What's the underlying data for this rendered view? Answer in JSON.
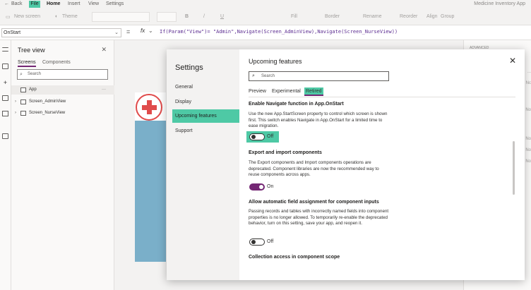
{
  "menubar": {
    "back": "Back",
    "file": "File",
    "home": "Home",
    "insert": "Insert",
    "view": "View",
    "settings": "Settings",
    "app_title": "Medicine Inventory App"
  },
  "toolbar": {
    "new_screen": "New screen",
    "theme": "Theme",
    "font_bold": "B",
    "font_italic": "/",
    "font_underline": "U",
    "fill": "Fill",
    "border": "Border",
    "rename": "Rename",
    "reorder": "Reorder",
    "align": "Align",
    "group": "Group"
  },
  "formula_bar": {
    "property": "OnStart",
    "equals": "=",
    "fx": "fx",
    "formula": "If(Param(\"View\")= \"Admin\",Navigate(Screen_AdminView),Navigate(Screen_NurseView))"
  },
  "tree_view": {
    "title": "Tree view",
    "tabs": [
      "Screens",
      "Components"
    ],
    "search_placeholder": "Search",
    "nodes": [
      {
        "label": "App",
        "more": "···"
      },
      {
        "label": "Screen_AdminView"
      },
      {
        "label": "Screen_NurseView"
      }
    ]
  },
  "right_panel": {
    "label": "ADVANCED",
    "values": [
      "...",
      "Nc",
      "No",
      "No",
      "No",
      "No"
    ]
  },
  "settings_dialog": {
    "title": "Settings",
    "nav": [
      "General",
      "Display",
      "Upcoming features",
      "Support"
    ],
    "active_nav": "Upcoming features",
    "header": "Upcoming features",
    "search_placeholder": "Search",
    "tabs": [
      "Preview",
      "Experimental",
      "Retired"
    ],
    "active_tab": "Retired",
    "features": [
      {
        "title": "Enable Navigate function in App.OnStart",
        "description": "Use the new App.StartScreen property to control which screen is shown first. This switch enables Navigate in App.OnStart for a limited time to ease migration.",
        "state": "Off"
      },
      {
        "title": "Export and import components",
        "description": "The Export components and Import components operations are deprecated. Component libraries are now the recommended way to reuse components across apps.",
        "state": "On"
      },
      {
        "title": "Allow automatic field assignment for component inputs",
        "description": "Passing records and tables with incorrectly named fields into component properties is no longer allowed. To temporarily re-enable the deprecated behavior, turn on this setting, save your app, and reopen it.",
        "state": "Off"
      },
      {
        "title": "Collection access in component scope"
      }
    ]
  },
  "colors": {
    "highlight": "#4ec9a5",
    "accent": "#742774"
  }
}
